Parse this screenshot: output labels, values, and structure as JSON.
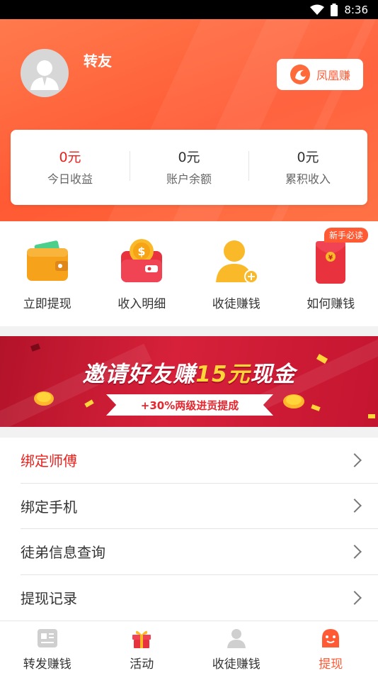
{
  "status_bar": {
    "time": "8:36",
    "icons": [
      "wifi-icon",
      "battery-icon"
    ]
  },
  "profile": {
    "username": "转友",
    "brand_button_label": "凤凰赚"
  },
  "stats": [
    {
      "value": "0元",
      "label": "今日收益",
      "color": "#e8211d"
    },
    {
      "value": "0元",
      "label": "账户余额",
      "color": "#333333"
    },
    {
      "value": "0元",
      "label": "累积收入",
      "color": "#333333"
    }
  ],
  "quick_actions": [
    {
      "label": "立即提现",
      "icon": "wallet-icon"
    },
    {
      "label": "收入明细",
      "icon": "coin-purse-icon"
    },
    {
      "label": "收徒赚钱",
      "icon": "add-user-icon"
    },
    {
      "label": "如何赚钱",
      "icon": "red-envelope-icon",
      "badge": "新手必读"
    }
  ],
  "banner": {
    "title_part1": "邀请好友赚",
    "title_highlight": "15元",
    "title_part2": "现金",
    "subtitle": "+30%两级进贡提成"
  },
  "menu": [
    {
      "label": "绑定师傅",
      "highlight": true
    },
    {
      "label": "绑定手机",
      "highlight": false
    },
    {
      "label": "徒弟信息查询",
      "highlight": false
    },
    {
      "label": "提现记录",
      "highlight": false
    }
  ],
  "tabs": [
    {
      "label": "转发赚钱",
      "icon": "news-icon",
      "active": false
    },
    {
      "label": "活动",
      "icon": "gift-icon",
      "active": false
    },
    {
      "label": "收徒赚钱",
      "icon": "user-icon",
      "active": false
    },
    {
      "label": "提现",
      "icon": "smile-face-icon",
      "active": true
    }
  ],
  "colors": {
    "accent": "#ff5a34",
    "highlight_red": "#e8211d",
    "banner_red": "#d7213a"
  }
}
